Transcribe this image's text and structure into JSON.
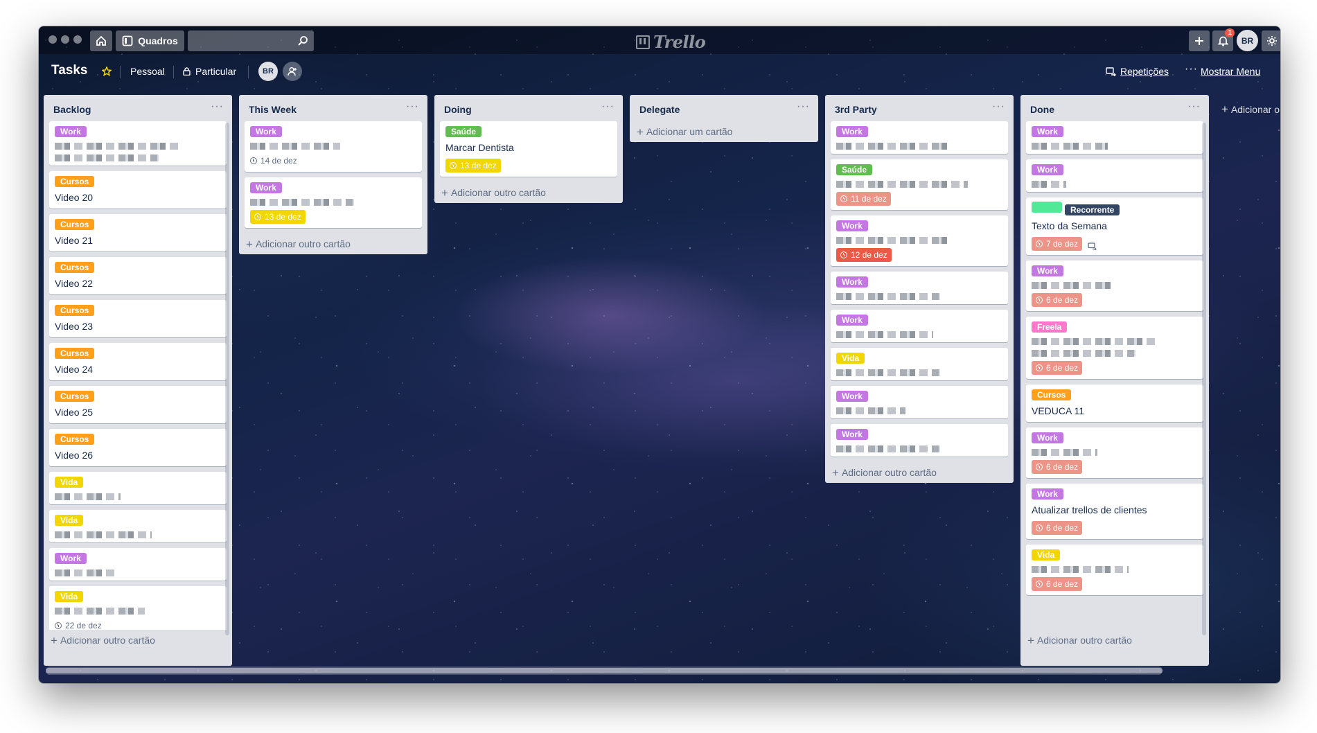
{
  "topbar": {
    "boards_label": "Quadros",
    "logo_text": "Trello",
    "avatar_initials": "BR",
    "notification_count": "1"
  },
  "board": {
    "title": "Tasks",
    "team": "Pessoal",
    "visibility": "Particular",
    "member_initials": "BR",
    "repeticoes_label": "Repetições",
    "menu_label": "Mostrar Menu",
    "add_list_label": "Adicionar o"
  },
  "colors": {
    "work": "#c377e0",
    "cursos": "#ff9f1a",
    "saude": "#61bd4f",
    "vida": "#f2d600",
    "freela": "#ff78cb",
    "recorrente": "#344563",
    "teal": "#51e898"
  },
  "lists": [
    {
      "title": "Backlog",
      "add_label": "Adicionar outro cartão",
      "cards": [
        {
          "label": "Work"
        },
        {
          "label": "Cursos",
          "title": "Video 20"
        },
        {
          "label": "Cursos",
          "title": "Video 21"
        },
        {
          "label": "Cursos",
          "title": "Video 22"
        },
        {
          "label": "Cursos",
          "title": "Video 23"
        },
        {
          "label": "Cursos",
          "title": "Video 24"
        },
        {
          "label": "Cursos",
          "title": "Video 25"
        },
        {
          "label": "Cursos",
          "title": "Video 26"
        },
        {
          "label": "Vida"
        },
        {
          "label": "Vida"
        },
        {
          "label": "Work"
        },
        {
          "label": "Vida",
          "due": "22 de dez"
        }
      ]
    },
    {
      "title": "This Week",
      "add_label": "Adicionar outro cartão",
      "cards": [
        {
          "label": "Work",
          "due": "14 de dez"
        },
        {
          "label": "Work",
          "due": "13 de dez"
        }
      ]
    },
    {
      "title": "Doing",
      "add_label": "Adicionar outro cartão",
      "cards": [
        {
          "label": "Saúde",
          "title": "Marcar Dentista",
          "due": "13 de dez"
        }
      ]
    },
    {
      "title": "Delegate",
      "add_label": "Adicionar um cartão",
      "cards": []
    },
    {
      "title": "3rd Party",
      "add_label": "Adicionar outro cartão",
      "cards": [
        {
          "label": "Work"
        },
        {
          "label": "Saúde",
          "due": "11 de dez"
        },
        {
          "label": "Work",
          "due": "12 de dez"
        },
        {
          "label": "Work"
        },
        {
          "label": "Work"
        },
        {
          "label": "Vida"
        },
        {
          "label": "Work"
        },
        {
          "label": "Work"
        }
      ]
    },
    {
      "title": "Done",
      "add_label": "Adicionar outro cartão",
      "cards": [
        {
          "label": "Work"
        },
        {
          "label": "Work"
        },
        {
          "label2": "Recorrente",
          "title": "Texto da Semana",
          "due": "7 de dez"
        },
        {
          "label": "Work",
          "due": "6 de dez"
        },
        {
          "label": "Freela",
          "due": "6 de dez"
        },
        {
          "label": "Cursos",
          "title": "VEDUCA 11"
        },
        {
          "label": "Work",
          "due": "6 de dez"
        },
        {
          "label": "Work",
          "title": "Atualizar trellos de clientes",
          "due": "6 de dez"
        },
        {
          "label": "Vida",
          "due": "6 de dez"
        }
      ]
    }
  ]
}
